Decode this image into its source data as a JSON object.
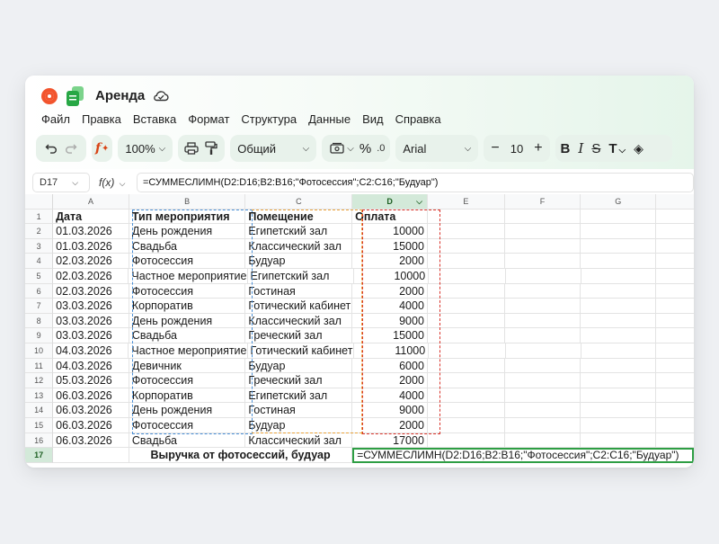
{
  "app": {
    "title": "Аренда"
  },
  "menu": [
    "Файл",
    "Правка",
    "Вставка",
    "Формат",
    "Структура",
    "Данные",
    "Вид",
    "Справка"
  ],
  "toolbar": {
    "zoom": "100%",
    "format": "Общий",
    "font": "Arial",
    "font_size": "10",
    "percent": "%",
    "func": "f"
  },
  "formula_bar": {
    "cell": "D17",
    "fx": "f(x)",
    "formula": "=СУММЕСЛИМН(D2:D16;B2:B16;\"Фотосессия\";C2:C16;\"Будуар\")"
  },
  "columns": [
    "A",
    "B",
    "C",
    "D",
    "E",
    "F",
    "G"
  ],
  "header_row": {
    "num": "1",
    "a": "Дата",
    "b": "Тип мероприятия",
    "c": "Помещение",
    "d": "Оплата"
  },
  "rows": [
    {
      "num": "2",
      "a": "01.03.2026",
      "b": "День рождения",
      "c": "Египетский зал",
      "d": "10000"
    },
    {
      "num": "3",
      "a": "01.03.2026",
      "b": "Свадьба",
      "c": "Классический зал",
      "d": "15000"
    },
    {
      "num": "4",
      "a": "02.03.2026",
      "b": "Фотосессия",
      "c": "Будуар",
      "d": "2000"
    },
    {
      "num": "5",
      "a": "02.03.2026",
      "b": "Частное мероприятие",
      "c": "Египетский зал",
      "d": "10000"
    },
    {
      "num": "6",
      "a": "02.03.2026",
      "b": "Фотосессия",
      "c": "Гостиная",
      "d": "2000"
    },
    {
      "num": "7",
      "a": "03.03.2026",
      "b": "Корпоратив",
      "c": "Готический кабинет",
      "d": "4000"
    },
    {
      "num": "8",
      "a": "03.03.2026",
      "b": "День рождения",
      "c": "Классический зал",
      "d": "9000"
    },
    {
      "num": "9",
      "a": "03.03.2026",
      "b": "Свадьба",
      "c": "Греческий зал",
      "d": "15000"
    },
    {
      "num": "10",
      "a": "04.03.2026",
      "b": "Частное мероприятие",
      "c": "Готический кабинет",
      "d": "11000"
    },
    {
      "num": "11",
      "a": "04.03.2026",
      "b": "Девичник",
      "c": "Будуар",
      "d": "6000"
    },
    {
      "num": "12",
      "a": "05.03.2026",
      "b": "Фотосессия",
      "c": "Греческий зал",
      "d": "2000"
    },
    {
      "num": "13",
      "a": "06.03.2026",
      "b": "Корпоратив",
      "c": "Египетский зал",
      "d": "4000"
    },
    {
      "num": "14",
      "a": "06.03.2026",
      "b": "День рождения",
      "c": "Гостиная",
      "d": "9000"
    },
    {
      "num": "15",
      "a": "06.03.2026",
      "b": "Фотосессия",
      "c": "Будуар",
      "d": "2000"
    },
    {
      "num": "16",
      "a": "06.03.2026",
      "b": "Свадьба",
      "c": "Классический зал",
      "d": "17000"
    }
  ],
  "summary_row": {
    "num": "17",
    "label": "Выручка от фотосессий, будуар",
    "formula": "=СУММЕСЛИМН(D2:D16;B2:B16;\"Фотосессия\";C2:C16;\"Будуар\")"
  },
  "colors": {
    "accent": "#2e7d32",
    "range_b": "#4a8fd6",
    "range_c": "#e9a23b",
    "range_d": "#d9342b",
    "active": "#2e9e44"
  }
}
